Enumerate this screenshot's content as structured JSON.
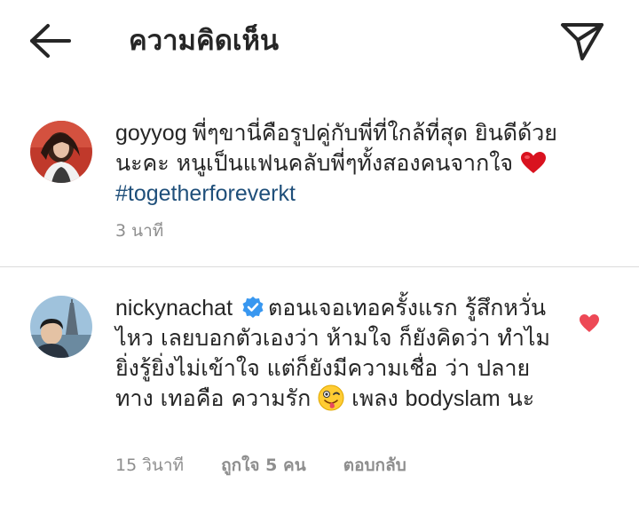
{
  "header": {
    "title": "ความคิดเห็น",
    "back_icon": "arrow-left-icon",
    "share_icon": "paper-plane-icon"
  },
  "comments": [
    {
      "username": "goyyog",
      "text_before_heart": "พี่ๆขานี่คือรูปคู่กับพี่ที่ใกล้ที่สุด ยินดีด้วยนะคะ หนูเป็นแฟนคลับพี่ๆทั้งสองคนจากใจ",
      "emoji": "red-heart",
      "hashtag": "#togetherforeverkt",
      "time": "3 นาที"
    },
    {
      "username": "nickynachat",
      "verified": true,
      "text_before_emoji": "ตอนเจอเทอครั้งแรก รู้สึกหวั่นไหว เลยบอกตัวเองว่า ห้ามใจ ก็ยังคิดว่า ทำไม ยิ่งรู้ยิ่งไม่เข้าใจ แต่ก็ยังมีความเชื่อ ว่า ปลายทาง เทอคือ ความรัก",
      "emoji": "winking-face-with-tongue",
      "text_after_emoji_1": " เพลง",
      "text_after_emoji_2": "bodyslam",
      "text_after_emoji_3": " นะ",
      "time": "15 วินาที",
      "likes": "ถูกใจ 5 คน",
      "reply": "ตอบกลับ",
      "liked": true
    }
  ],
  "colors": {
    "text": "#262626",
    "meta": "#8e8e8e",
    "hashtag": "#1f4f7a",
    "like_red": "#ed4956",
    "verified_blue": "#3897f0"
  }
}
